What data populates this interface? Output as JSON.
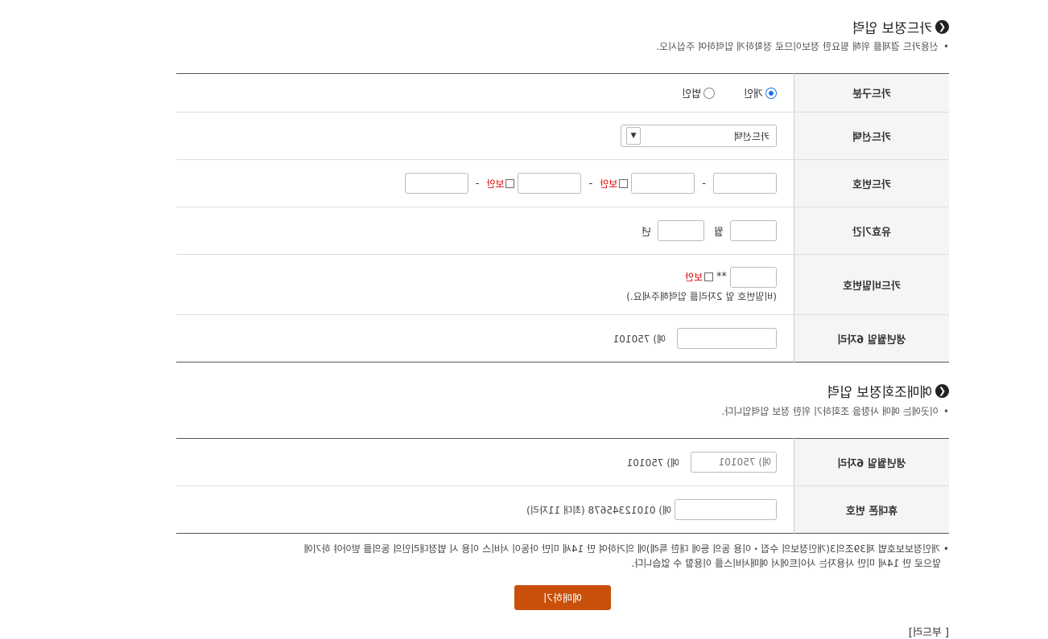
{
  "card_section": {
    "title": "카드정보 입력",
    "notice": "신용카드 결제를 위해 필요한 정보이므로 정확하게 입력하여 주십시오.",
    "card_type": {
      "label": "카드구분",
      "options": [
        "개인",
        "법인"
      ],
      "selected": "개인"
    },
    "card_select": {
      "label": "카드선택",
      "value": "카드선택"
    },
    "card_number": {
      "label": "카드번호",
      "secure_label": "보안"
    },
    "expiry": {
      "label": "유효기간",
      "month_unit": "월",
      "year_unit": "년"
    },
    "password": {
      "label": "카드비밀번호",
      "mask": "**",
      "secure_label": "보안",
      "hint": "(비밀번호 앞 2자리를 입력해주세요.)"
    },
    "birth": {
      "label": "생년월일 6자리",
      "hint": "예) 750101"
    }
  },
  "reservation_section": {
    "title": "예매조회정보 입력",
    "notice": "이곳에는 예매 사항을 조회하기 위한 정보 입력입니다.",
    "birth": {
      "label": "생년월일 6자리",
      "placeholder": "예) 750101",
      "hint": "예) 750101"
    },
    "phone": {
      "label": "휴대폰 번호",
      "hint": "예) 01012345678 (최대 11자리)"
    }
  },
  "bottom_notice": {
    "line1": "개인정보보호법 제39조의3(개인정보의 수집・이용 동의 등에 대한 특례)에 의거하여 만 14세 미만 아동이 서비스 이용 시 법정대리인의 동의를 받아야 하기에",
    "line2": "앞으로 만 14세 미만 사용자는 사이트에서 예매서비스를 이용할 수 없습니다."
  },
  "submit_label": "예매하기",
  "cut_text": "[ 부드러]"
}
